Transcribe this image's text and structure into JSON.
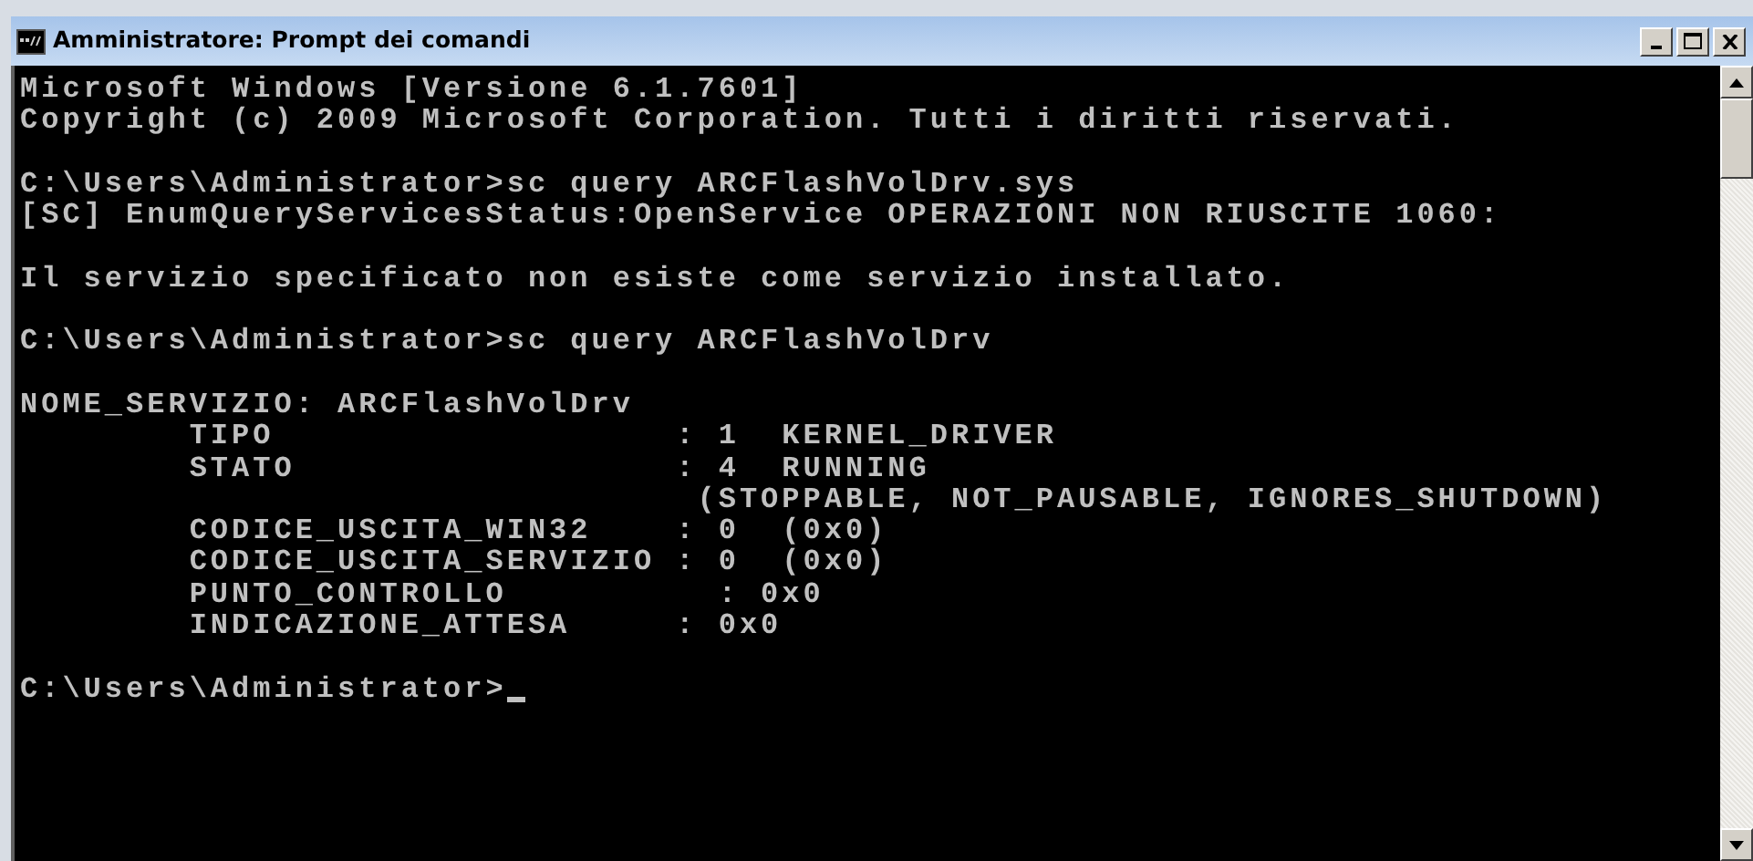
{
  "window": {
    "title": "Amministratore: Prompt dei comandi"
  },
  "console": {
    "blocks": [
      [
        "Microsoft Windows [Versione 6.1.7601]",
        "Copyright (c) 2009 Microsoft Corporation. Tutti i diritti riservati."
      ],
      [
        "C:\\Users\\Administrator>sc query ARCFlashVolDrv.sys",
        "[SC] EnumQueryServicesStatus:OpenService OPERAZIONI NON RIUSCITE 1060:"
      ],
      [
        "Il servizio specificato non esiste come servizio installato."
      ],
      [
        "C:\\Users\\Administrator>sc query ARCFlashVolDrv"
      ],
      [
        "NOME_SERVIZIO: ARCFlashVolDrv",
        "        TIPO                   : 1  KERNEL_DRIVER",
        "        STATO                  : 4  RUNNING",
        "                                (STOPPABLE, NOT_PAUSABLE, IGNORES_SHUTDOWN)",
        "        CODICE_USCITA_WIN32    : 0  (0x0)",
        "        CODICE_USCITA_SERVIZIO : 0  (0x0)",
        "        PUNTO_CONTROLLO          : 0x0",
        "        INDICAZIONE_ATTESA     : 0x0"
      ]
    ],
    "prompt": "C:\\Users\\Administrator>"
  }
}
